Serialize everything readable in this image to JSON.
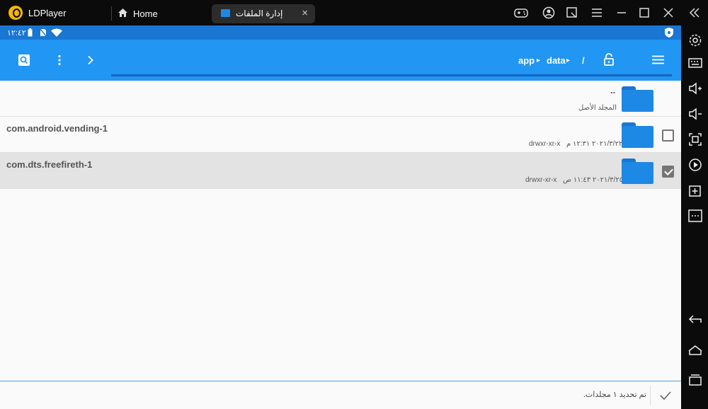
{
  "window": {
    "app_name": "LDPlayer",
    "home_tab_label": "Home",
    "active_tab_label": "إدارة الملفات",
    "close_tab_glyph": "×"
  },
  "statusbar": {
    "time": "١٢:٤٢"
  },
  "toolbar": {
    "breadcrumb_root": "/",
    "breadcrumb_items": [
      "data",
      "app"
    ],
    "breadcrumb_separator": "▸"
  },
  "files": [
    {
      "name": "..",
      "subtitle": "المجلد الأصل",
      "selected": null
    },
    {
      "name": "com.android.vending-1",
      "permissions": "drwxr-xr-x",
      "date": "٢٠٢١/٣/٢٢ ١٢:٣١ م",
      "selected": false
    },
    {
      "name": "com.dts.freefireth-1",
      "permissions": "drwxr-xr-x",
      "date": "٢٠٢١/٣/٢٥ ١١:٤٣ ص",
      "selected": true
    }
  ],
  "footer": {
    "status_text": "تم تحديد ١ مجلدات."
  },
  "colors": {
    "appbar": "#2196f3",
    "statusbar": "#1976d2",
    "folder": "#1e88e5",
    "ldplayer_logo": "#f5b800"
  }
}
